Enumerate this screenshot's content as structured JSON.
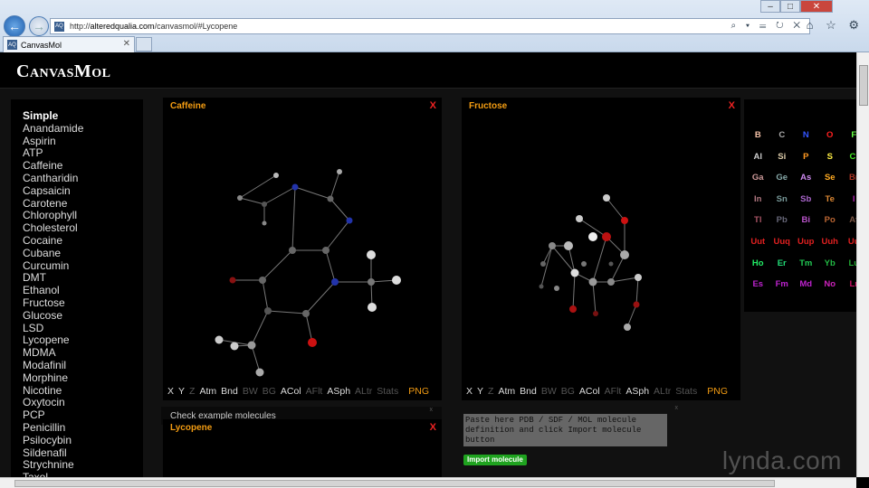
{
  "browser": {
    "url_prefix": "http://",
    "url_domain": "alteredqualia.com",
    "url_path": "/canvasmol/#Lycopene",
    "addr_controls": "⌕ ▾ ☰ ↻ ✕",
    "tab_title": "CanvasMol",
    "tab_close": "✕",
    "favicon_text": "AQ",
    "win_min": "–",
    "win_max": "□",
    "win_close": "✕",
    "toolbar_icons": "⌂ ☆ ⚙"
  },
  "site": {
    "brand": "CanvasMol"
  },
  "sidebar": {
    "category": "Simple",
    "items": [
      "Anandamide",
      "Aspirin",
      "ATP",
      "Caffeine",
      "Cantharidin",
      "Capsaicin",
      "Carotene",
      "Chlorophyll",
      "Cholesterol",
      "Cocaine",
      "Cubane",
      "Curcumin",
      "DMT",
      "Ethanol",
      "Fructose",
      "Glucose",
      "LSD",
      "Lycopene",
      "MDMA",
      "Modafinil",
      "Morphine",
      "Nicotine",
      "Oxytocin",
      "PCP",
      "Penicillin",
      "Psilocybin",
      "Sildenafil",
      "Strychnine",
      "Taxol"
    ]
  },
  "panels": {
    "caffeine": {
      "title": "Caffeine",
      "close": "X"
    },
    "fructose": {
      "title": "Fructose",
      "close": "X"
    },
    "lycopene": {
      "title": "Lycopene",
      "close": "X"
    }
  },
  "toolbar": [
    {
      "label": "X",
      "state": "on"
    },
    {
      "label": "Y",
      "state": "on"
    },
    {
      "label": "Z",
      "state": "off"
    },
    {
      "label": "Atm",
      "state": "on"
    },
    {
      "label": "Bnd",
      "state": "on"
    },
    {
      "label": "BW",
      "state": "off"
    },
    {
      "label": "BG",
      "state": "off"
    },
    {
      "label": "ACol",
      "state": "on"
    },
    {
      "label": "AFlt",
      "state": "off"
    },
    {
      "label": "ASph",
      "state": "on"
    },
    {
      "label": "ALtr",
      "state": "off"
    },
    {
      "label": "Stats",
      "state": "off"
    },
    {
      "label": "PNG",
      "state": "png"
    }
  ],
  "periodic_table": [
    [
      {
        "s": "B",
        "c": "#f5c2a8"
      },
      {
        "s": "C",
        "c": "#aaaaaa"
      },
      {
        "s": "N",
        "c": "#3355ff"
      },
      {
        "s": "O",
        "c": "#ff2020"
      },
      {
        "s": "F",
        "c": "#66ff44"
      }
    ],
    [
      {
        "s": "Al",
        "c": "#cccccc"
      },
      {
        "s": "Si",
        "c": "#ddccaa"
      },
      {
        "s": "P",
        "c": "#ff9922"
      },
      {
        "s": "S",
        "c": "#ffee44"
      },
      {
        "s": "Cl",
        "c": "#44ee22"
      }
    ],
    [
      {
        "s": "Ga",
        "c": "#cc9999"
      },
      {
        "s": "Ge",
        "c": "#88aaaa"
      },
      {
        "s": "As",
        "c": "#cc88ee"
      },
      {
        "s": "Se",
        "c": "#ffaa22"
      },
      {
        "s": "Br",
        "c": "#aa3322"
      }
    ],
    [
      {
        "s": "In",
        "c": "#b07780"
      },
      {
        "s": "Sn",
        "c": "#779999"
      },
      {
        "s": "Sb",
        "c": "#aa66cc"
      },
      {
        "s": "Te",
        "c": "#dd8833"
      },
      {
        "s": "I",
        "c": "#aa22aa"
      }
    ],
    [
      {
        "s": "Tl",
        "c": "#aa5566"
      },
      {
        "s": "Pb",
        "c": "#666677"
      },
      {
        "s": "Bi",
        "c": "#bb55cc"
      },
      {
        "s": "Po",
        "c": "#bb6633"
      },
      {
        "s": "At",
        "c": "#775544"
      }
    ],
    [
      {
        "s": "Uut",
        "c": "#e02020"
      },
      {
        "s": "Uuq",
        "c": "#e02020"
      },
      {
        "s": "Uup",
        "c": "#e02020"
      },
      {
        "s": "Uuh",
        "c": "#e02020"
      },
      {
        "s": "Uu",
        "c": "#e02020"
      }
    ],
    [
      {
        "s": "Ho",
        "c": "#22ee66"
      },
      {
        "s": "Er",
        "c": "#22dd77"
      },
      {
        "s": "Tm",
        "c": "#22cc55"
      },
      {
        "s": "Yb",
        "c": "#22bb44"
      },
      {
        "s": "Lu",
        "c": "#22aa33"
      }
    ],
    [
      {
        "s": "Es",
        "c": "#bb22cc"
      },
      {
        "s": "Fm",
        "c": "#bb22cc"
      },
      {
        "s": "Md",
        "c": "#bb22cc"
      },
      {
        "s": "No",
        "c": "#cc22bb"
      },
      {
        "s": "Lr",
        "c": "#cc1166"
      }
    ]
  ],
  "check_examples": "Check example molecules",
  "import": {
    "placeholder": "Paste here PDB / SDF / MOL molecule definition and click Import molecule button",
    "button": "Import molecule"
  },
  "watermark": "lynda.com"
}
